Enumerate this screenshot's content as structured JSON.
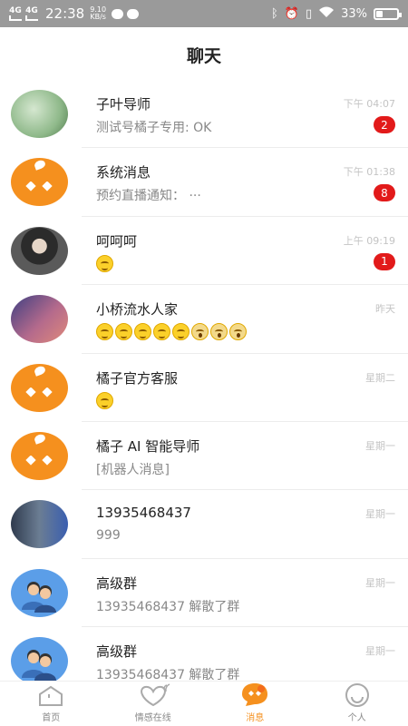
{
  "status": {
    "network1": "4G",
    "network2": "4G",
    "time": "22:38",
    "speed_value": "9.10",
    "speed_unit": "KB/s",
    "battery": "33%",
    "battery_level": 0.33
  },
  "header": {
    "title": "聊天"
  },
  "chats": [
    {
      "name": "子叶导师",
      "message": "测试号橘子专用: OK",
      "time": "下午 04:07",
      "badge": "2",
      "avatar": "photo-nature"
    },
    {
      "name": "系统消息",
      "message": "预约直播通知：  ···",
      "time": "下午 01:38",
      "badge": "8",
      "avatar": "orange-logo"
    },
    {
      "name": "呵呵呵",
      "message": "",
      "time": "上午 09:19",
      "badge": "1",
      "avatar": "photo-person",
      "emojis": [
        "tongue"
      ]
    },
    {
      "name": "小桥流水人家",
      "message": "",
      "time": "昨天",
      "badge": "",
      "avatar": "photo-sky",
      "emojis": [
        "grin",
        "grin",
        "grin",
        "grin",
        "grin",
        "scream",
        "scream",
        "scream"
      ]
    },
    {
      "name": "橘子官方客服",
      "message": "",
      "time": "星期二",
      "badge": "",
      "avatar": "orange-logo",
      "emojis": [
        "dizzy"
      ]
    },
    {
      "name": "橘子 AI 智能导师",
      "message": "[机器人消息]",
      "time": "星期一",
      "badge": "",
      "avatar": "orange-logo"
    },
    {
      "name": "13935468437",
      "message": "999",
      "time": "星期一",
      "badge": "",
      "avatar": "photo-meeting"
    },
    {
      "name": "高级群",
      "message": "13935468437 解散了群",
      "time": "星期一",
      "badge": "",
      "avatar": "group-icon"
    },
    {
      "name": "高级群",
      "message": "13935468437 解散了群",
      "time": "星期一",
      "badge": "",
      "avatar": "group-icon"
    }
  ],
  "tabbar": {
    "tabs": [
      {
        "label": "首页",
        "icon": "home-icon",
        "active": false
      },
      {
        "label": "情感在线",
        "icon": "heart-signal-icon",
        "active": false
      },
      {
        "label": "消息",
        "icon": "message-icon",
        "active": true
      },
      {
        "label": "个人",
        "icon": "profile-icon",
        "active": false
      }
    ]
  },
  "colors": {
    "accent": "#f5901e",
    "badge": "#e21a1a",
    "statusbar": "#9a9a9a"
  }
}
